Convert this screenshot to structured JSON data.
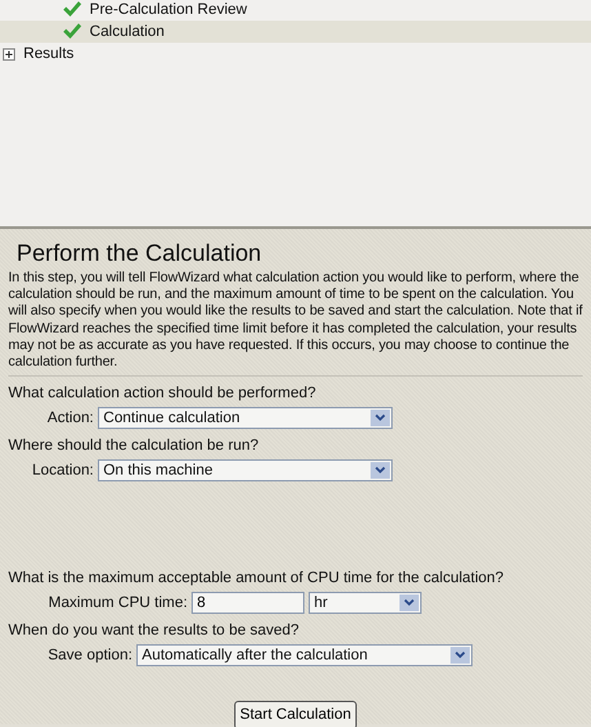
{
  "tree": [
    {
      "label": "Pre-Calculation Review",
      "kind": "step",
      "complete": true,
      "selected": false
    },
    {
      "label": "Calculation",
      "kind": "step",
      "complete": true,
      "selected": true
    },
    {
      "label": "Results",
      "kind": "folder",
      "expanded": false
    }
  ],
  "panel": {
    "title": "Perform the Calculation",
    "description": "In this step, you will tell FlowWizard what calculation action you would like to perform, where the calculation should be run, and the maximum amount of time to be spent on the calculation. You will also specify when you would like the results to be saved and start the calculation. Note that if FlowWizard reaches the specified time limit before it has completed the calculation, your results may not be as accurate as you have requested. If this occurs, you may choose to continue the calculation further.",
    "sections": [
      {
        "question": "What calculation action should be performed?",
        "label": "Action:",
        "kind": "select",
        "value": "Continue calculation"
      },
      {
        "question": "Where should the calculation be run?",
        "label": "Location:",
        "kind": "select",
        "value": "On this machine"
      },
      {
        "question": "What is the maximum acceptable amount of CPU time for the calculation?",
        "label": "Maximum CPU time:",
        "kind": "time",
        "value": "8",
        "unit": "hr"
      },
      {
        "question": "When do you want the results to be saved?",
        "label": "Save option:",
        "kind": "select",
        "value": "Automatically after the calculation"
      }
    ],
    "button": "Start Calculation"
  }
}
